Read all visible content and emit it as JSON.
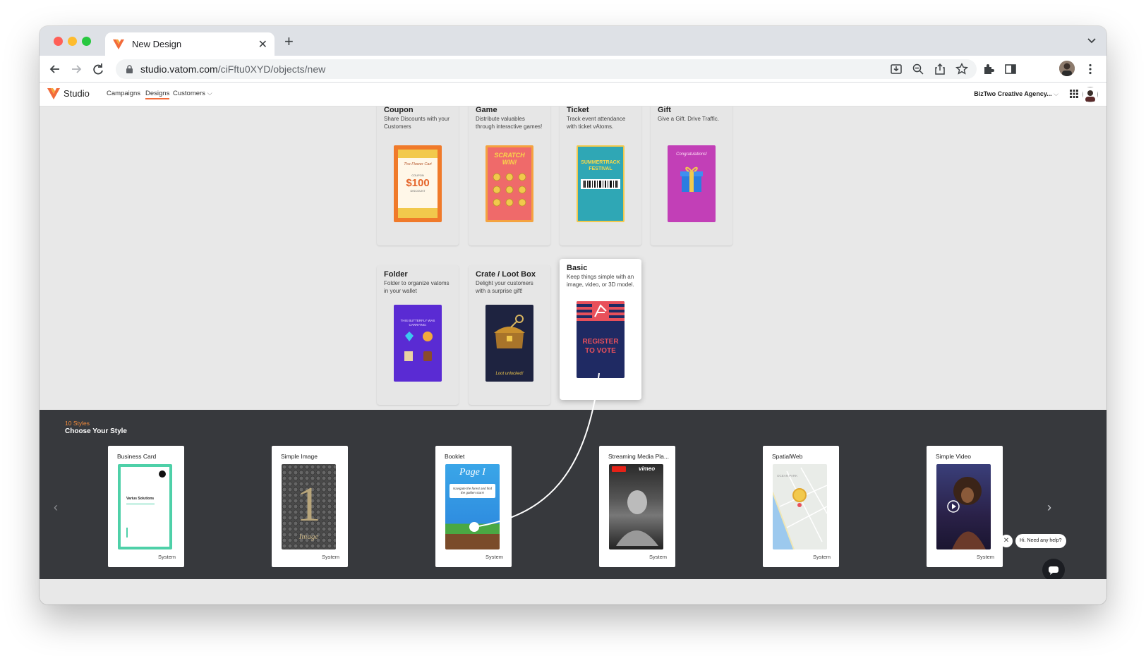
{
  "browser": {
    "tab_title": "New Design",
    "url_host": "studio.vatom.com",
    "url_path": "/ciFftu0XYD/objects/new"
  },
  "app": {
    "brand": "Studio",
    "nav": [
      "Campaigns",
      "Designs",
      "Customers"
    ],
    "active_nav": "Designs",
    "org_name": "BizTwo Creative Agency..."
  },
  "categories": [
    {
      "title": "Coupon",
      "desc": "Share Discounts with your Customers",
      "thumb": {
        "top_text": "The Flower Cart",
        "sub": "COUPON",
        "value": "$100",
        "foot": "DISCOUNT"
      }
    },
    {
      "title": "Game",
      "desc": "Distribute valuables through interactive games!",
      "thumb": {
        "text": "SCRATCH WIN!"
      }
    },
    {
      "title": "Ticket",
      "desc": "Track event attendance with ticket vAtoms.",
      "thumb": {
        "text": "SUMMERTRACK FESTIVAL"
      }
    },
    {
      "title": "Gift",
      "desc": "Give a Gift. Drive Traffic.",
      "thumb": {
        "text": "Congratulations!"
      }
    },
    {
      "title": "Folder",
      "desc": "Folder to organize vatoms in your wallet",
      "thumb": {
        "text": "THIS BUTTERFLY WAS CARRYING:"
      }
    },
    {
      "title": "Crate / Loot Box",
      "desc": "Delight your customers with a surprise gift!",
      "thumb": {
        "text": "Loot unlocked!"
      }
    },
    {
      "title": "Basic",
      "desc": "Keep things simple with an image, video, or 3D model.",
      "thumb": {
        "text": "REGISTER TO VOTE"
      }
    }
  ],
  "styles": {
    "count_label": "10 Styles",
    "title": "Choose Your Style",
    "items": [
      {
        "label": "Business Card",
        "tag": "System",
        "thumb_text": "Varius Solutions"
      },
      {
        "label": "Simple Image",
        "tag": "System",
        "thumb_text": "Image"
      },
      {
        "label": "Booklet",
        "tag": "System",
        "thumb_text": "Page I",
        "thumb_sub": "Navigate the forest and find the golden stars!"
      },
      {
        "label": "Streaming Media Pla...",
        "tag": "System",
        "thumb_text": "vimeo"
      },
      {
        "label": "SpatialWeb",
        "tag": "System",
        "thumb_text": "OCEAN PARK"
      },
      {
        "label": "Simple Video",
        "tag": "System",
        "thumb_text": ""
      }
    ]
  },
  "help": {
    "bubble": "Hi. Need any help?"
  },
  "colors": {
    "accent": "#f26b3a",
    "panel": "#37393d",
    "count": "#f08a3c"
  }
}
